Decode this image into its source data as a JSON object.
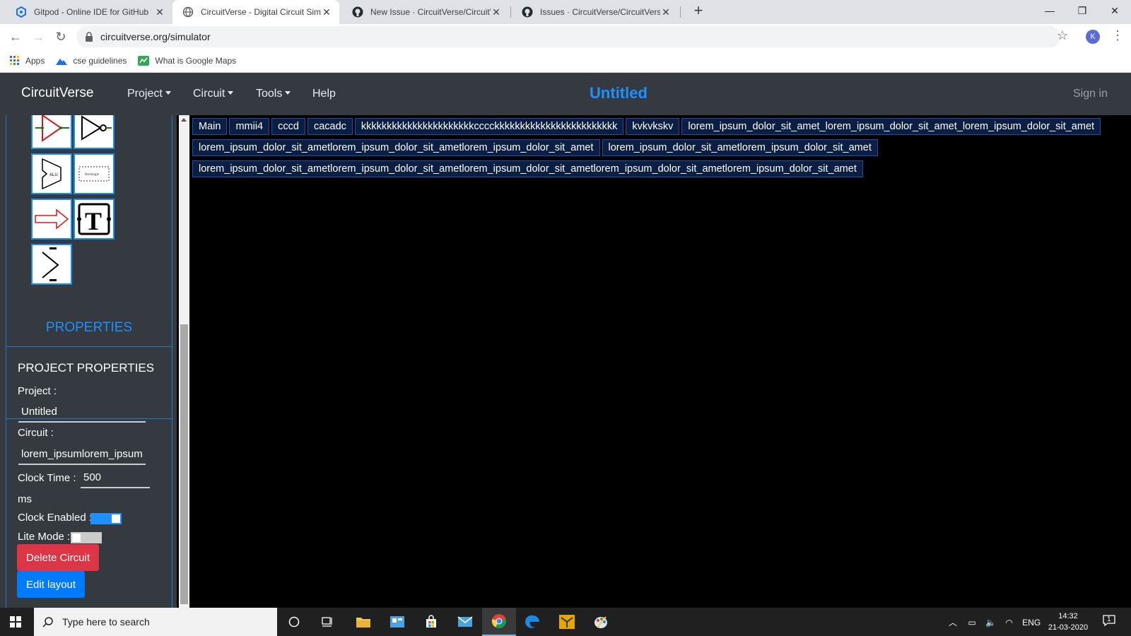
{
  "browser": {
    "tabs": [
      {
        "title": "Gitpod - Online IDE for GitHub",
        "icon": "gitpod-icon"
      },
      {
        "title": "CircuitVerse - Digital Circuit Simu",
        "icon": "globe-icon"
      },
      {
        "title": "New Issue · CircuitVerse/CircuitVe",
        "icon": "github-icon"
      },
      {
        "title": "Issues · CircuitVerse/CircuitVerse",
        "icon": "github-icon"
      }
    ],
    "url": "circuitverse.org/simulator",
    "avatar_initial": "K",
    "bookmarks": [
      {
        "label": "Apps",
        "icon": "apps-grid-icon"
      },
      {
        "label": "cse guidelines",
        "icon": "mountain-icon"
      },
      {
        "label": "What is Google Maps",
        "icon": "maps-icon"
      }
    ]
  },
  "navbar": {
    "brand": "CircuitVerse",
    "menus": [
      "Project",
      "Circuit",
      "Tools",
      "Help"
    ],
    "project_title": "Untitled",
    "sign_in": "Sign in",
    "accent": "#1e90ff"
  },
  "properties": {
    "heading": "PROPERTIES",
    "section_title": "PROJECT PROPERTIES",
    "project_label": "Project :",
    "project_value": "Untitled",
    "circuit_label": "Circuit :",
    "circuit_value": "lorem_ipsumlorem_ipsum",
    "clock_time_label": "Clock Time :",
    "clock_time_value": "500",
    "clock_time_unit": "ms",
    "clock_enabled_label": "Clock Enabled :",
    "clock_enabled": true,
    "lite_mode_label": "Lite Mode :",
    "lite_mode": false,
    "delete_button": "Delete Circuit",
    "edit_layout_button": "Edit layout"
  },
  "circuit_tabs": [
    "Main",
    "mmii4",
    "cccd",
    "cacadc",
    "kkkkkkkkkkkkkkkkkkkkkkcccckkkkkkkkkkkkkkkkkkkkkkkk",
    "kvkvkskv",
    "lorem_ipsum_dolor_sit_amet_lorem_ipsum_dolor_sit_amet_lorem_ipsum_dolor_sit_amet",
    "lorem_ipsum_dolor_sit_ametlorem_ipsum_dolor_sit_ametlorem_ipsum_dolor_sit_amet",
    "lorem_ipsum_dolor_sit_ametlorem_ipsum_dolor_sit_amet",
    "lorem_ipsum_dolor_sit_ametlorem_ipsum_dolor_sit_ametlorem_ipsum_dolor_sit_ametlorem_ipsum_dolor_sit_ametlorem_ipsum_dolor_sit_amet"
  ],
  "taskbar": {
    "search_placeholder": "Type here to search",
    "language": "ENG",
    "time": "14:32",
    "date": "21-03-2020",
    "notification_count": "1"
  }
}
